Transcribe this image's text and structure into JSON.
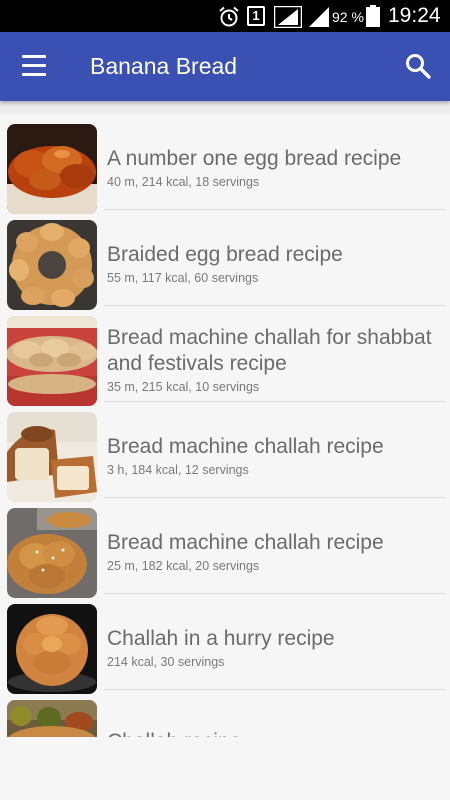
{
  "status_bar": {
    "battery_percent": "92 %",
    "time": "19:24",
    "sim_label": "1",
    "icons": [
      "alarm-icon",
      "sim-icon",
      "signal-icon",
      "signal-icon",
      "battery-icon"
    ]
  },
  "app_bar": {
    "title": "Banana Bread",
    "menu_icon": "menu-icon",
    "search_icon": "search-icon",
    "color": "#3a50b3"
  },
  "recipes": [
    {
      "title": "A number one egg bread recipe",
      "meta": "40 m, 214 kcal, 18 servings"
    },
    {
      "title": "Braided egg bread recipe",
      "meta": "55 m, 117 kcal, 60 servings"
    },
    {
      "title": "Bread machine challah for shabbat and festivals recipe",
      "meta": "35 m, 215 kcal, 10 servings"
    },
    {
      "title": "Bread machine challah recipe",
      "meta": "3 h, 184 kcal, 12 servings"
    },
    {
      "title": "Bread machine challah recipe",
      "meta": "25 m, 182 kcal, 20 servings"
    },
    {
      "title": "Challah in a hurry recipe",
      "meta": "214 kcal, 30 servings"
    },
    {
      "title": "Challah recipe",
      "meta": ""
    }
  ]
}
